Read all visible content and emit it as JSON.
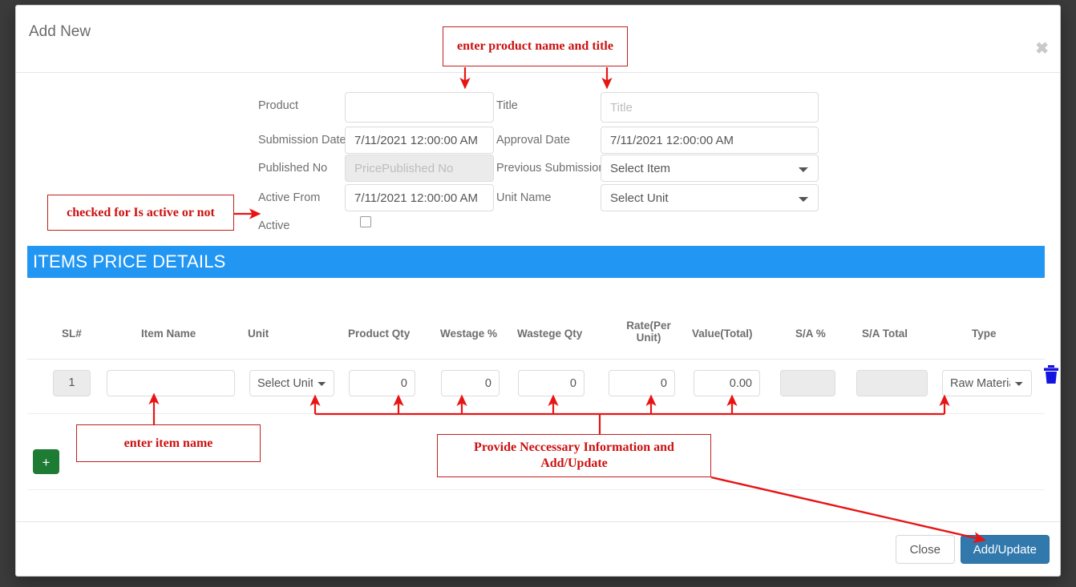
{
  "modal": {
    "title": "Add New",
    "close_icon": "close-icon",
    "close_label": "✖"
  },
  "form": {
    "rows": [
      {
        "left_label": "Product",
        "left_value": "",
        "left_placeholder": "",
        "right_label": "Title",
        "right_value": "",
        "right_placeholder": "Title"
      },
      {
        "left_label": "Submission Date",
        "left_value": "7/11/2021 12:00:00 AM",
        "left_placeholder": "",
        "right_label": "Approval Date",
        "right_value": "7/11/2021 12:00:00 AM",
        "right_placeholder": ""
      },
      {
        "left_label": "Published No",
        "left_value": "",
        "left_placeholder": "PricePublished No",
        "right_label": "Previous Submission",
        "right_value": "Select Item",
        "right_placeholder": ""
      },
      {
        "left_label": "Active From",
        "left_value": "7/11/2021 12:00:00 AM",
        "left_placeholder": "",
        "right_label": "Unit Name",
        "right_value": "Select Unit",
        "right_placeholder": ""
      }
    ],
    "active_label": "Active",
    "active_checked": false
  },
  "section": {
    "banner_title": "ITEMS PRICE DETAILS",
    "banner_color": "#2196f3"
  },
  "table": {
    "headers": [
      "SL#",
      "Item Name",
      "Unit",
      "Product Qty",
      "Westage %",
      "Wastege Qty",
      "Rate(Per Unit)",
      "Value(Total)",
      "S/A %",
      "S/A Total",
      "Type"
    ],
    "rows": [
      {
        "sl": "1",
        "item_name": "",
        "unit": "Select Unit",
        "product_qty": "0",
        "westage_pct": "0",
        "wastege_qty": "0",
        "rate_per_unit": "0",
        "value_total": "0.00",
        "sa_pct": "",
        "sa_total": "",
        "type": "Raw Materia"
      }
    ],
    "add_row_label": "+",
    "delete_icon": "trash-icon"
  },
  "footer": {
    "close_label": "Close",
    "submit_label": "Add/Update",
    "submit_color": "#3179ad"
  },
  "annotations": [
    {
      "id": "a1",
      "text": "enter product name and title"
    },
    {
      "id": "a2",
      "text": "checked for Is active or not"
    },
    {
      "id": "a3",
      "text": "enter item name"
    },
    {
      "id": "a4",
      "text": "Provide Neccessary Information and Add/Update"
    }
  ],
  "colors": {
    "annotation": "#cc1111",
    "annotation_border": "#c0201d",
    "banner": "#2196f3",
    "primary_button": "#3179ad",
    "add_button": "#1d7b33",
    "trash": "#1414e0"
  }
}
